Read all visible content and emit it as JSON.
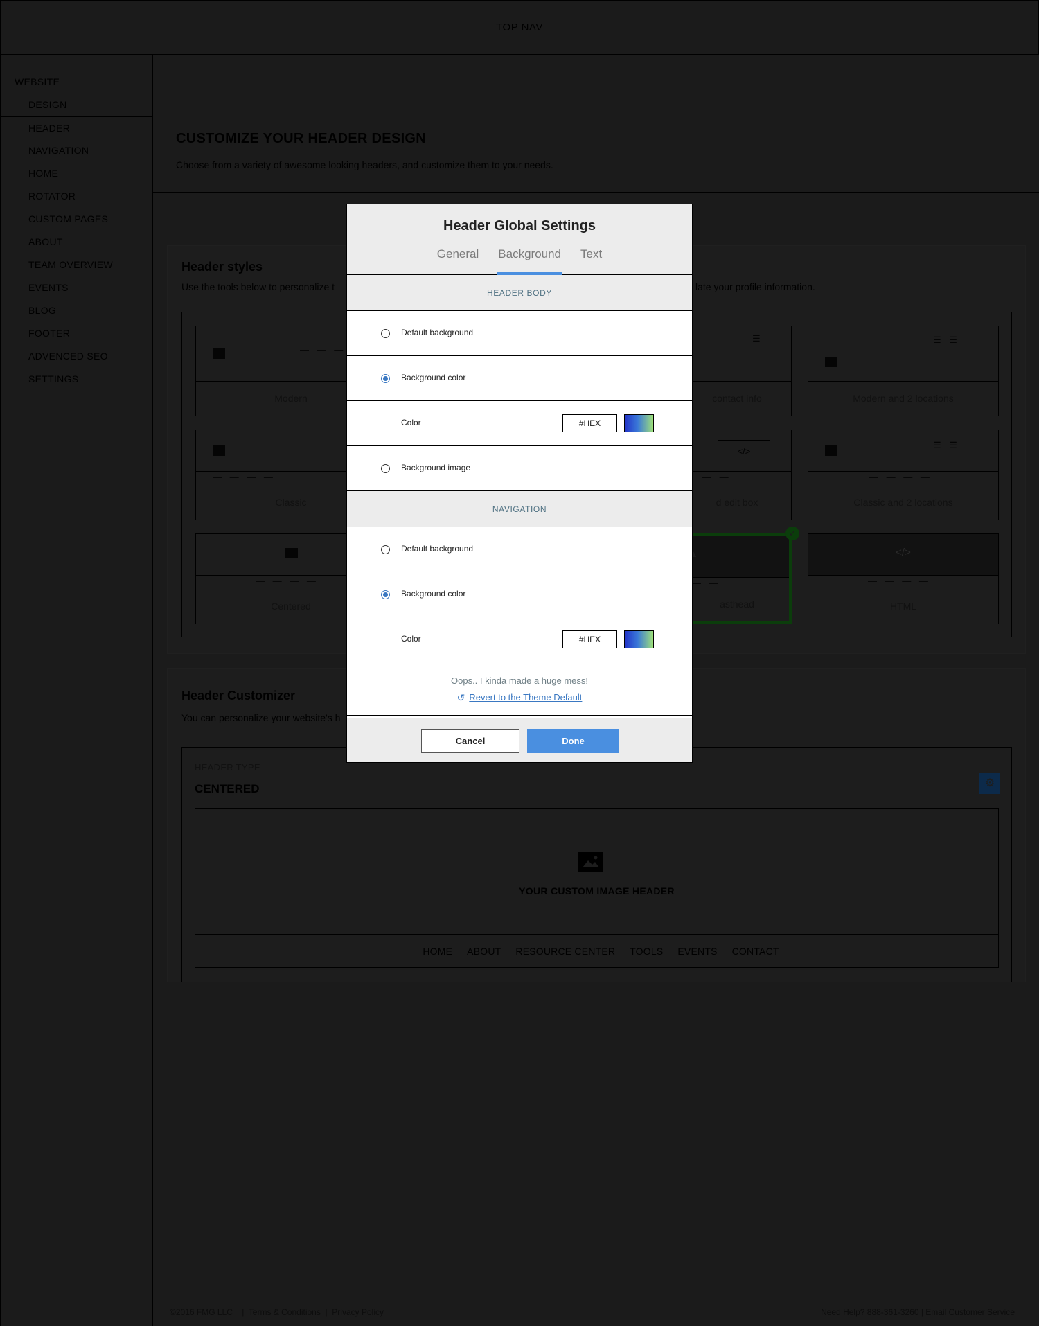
{
  "topnav": {
    "label": "TOP NAV"
  },
  "sidebar": {
    "title": "WEBSITE",
    "items": [
      {
        "label": "DESIGN"
      },
      {
        "label": "HEADER"
      },
      {
        "label": "NAVIGATION"
      },
      {
        "label": "HOME"
      },
      {
        "label": "ROTATOR"
      },
      {
        "label": "CUSTOM PAGES"
      },
      {
        "label": "ABOUT"
      },
      {
        "label": "TEAM OVERVIEW"
      },
      {
        "label": "EVENTS"
      },
      {
        "label": "BLOG"
      },
      {
        "label": "FOOTER"
      },
      {
        "label": "ADVENCED SEO"
      },
      {
        "label": "SETTINGS"
      }
    ],
    "active_index": 1
  },
  "page": {
    "title": "CUSTOMIZE YOUR HEADER DESIGN",
    "subtitle": "Choose from a variety of awesome looking headers, and customize them to your needs."
  },
  "header_styles": {
    "title": "Header styles",
    "description_start": "Use the tools below to personalize t",
    "description_end": "late your profile information.",
    "cards": [
      {
        "label": "Modern"
      },
      {
        "label": "contact info"
      },
      {
        "label": "Modern and 2 locations"
      },
      {
        "label": "Classic"
      },
      {
        "label": "d edit box"
      },
      {
        "label": "Classic and 2 locations"
      },
      {
        "label": "Centered"
      },
      {
        "label": "asthead"
      },
      {
        "label": "HTML"
      }
    ],
    "selected_check": "✓",
    "code_icon": "code-icon"
  },
  "header_customizer": {
    "title": "Header Customizer",
    "description": "You can personalize your website's h",
    "type_label": "HEADER TYPE",
    "type_value": "CENTERED",
    "gear_icon": "gear-icon",
    "preview_caption": "YOUR CUSTOM IMAGE HEADER",
    "preview_nav": [
      "HOME",
      "ABOUT",
      "RESOURCE CENTER",
      "TOOLS",
      "EVENTS",
      "CONTACT"
    ]
  },
  "footer": {
    "copyright": "©2016 FMG LLC",
    "terms": "Terms & Conditions",
    "privacy": "Privacy Policy",
    "help": "Need Help? 888-361-3260 | Email Customer Service"
  },
  "modal": {
    "title": "Header Global Settings",
    "tabs": [
      {
        "label": "General"
      },
      {
        "label": "Background"
      },
      {
        "label": "Text"
      }
    ],
    "active_tab": "Background",
    "header_body": {
      "section_label": "HEADER BODY",
      "default_bg_label": "Default background",
      "bg_color_label": "Background color",
      "color_label": "Color",
      "hex_placeholder": "#HEX",
      "bg_image_label": "Background image",
      "selected": "Background color"
    },
    "navigation": {
      "section_label": "NAVIGATION",
      "default_bg_label": "Default background",
      "bg_color_label": "Background color",
      "color_label": "Color",
      "hex_placeholder": "#HEX",
      "selected": "Background color"
    },
    "mess_text": "Oops.. I kinda made a huge mess!",
    "revert_icon": "history-icon",
    "revert_label": "Revert to the Theme Default",
    "cancel_label": "Cancel",
    "done_label": "Done",
    "accent_color": "#4a8fe0"
  }
}
